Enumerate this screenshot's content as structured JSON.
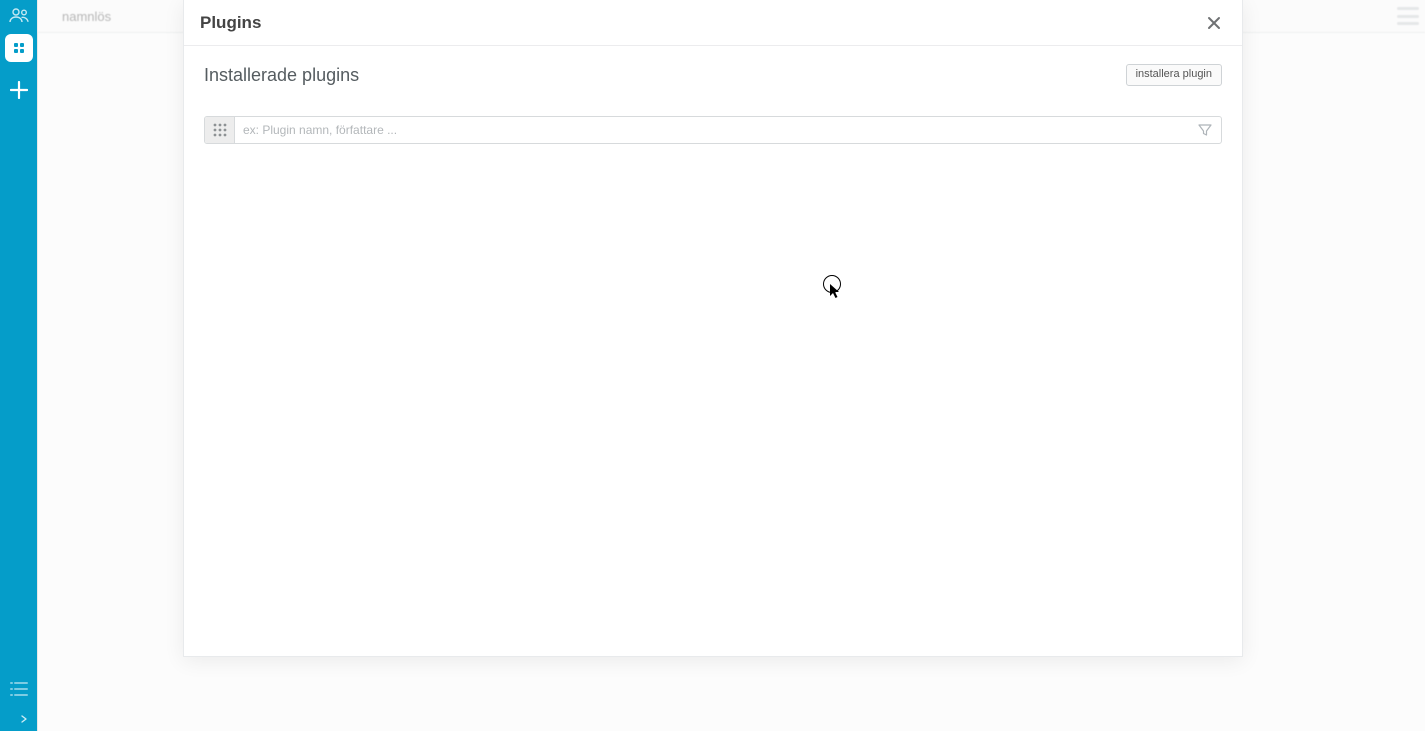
{
  "sidebar": {
    "add_label": "+"
  },
  "page": {
    "title": "namnlös"
  },
  "modal": {
    "title": "Plugins",
    "subtitle": "Installerade plugins",
    "install_btn": "installera plugin",
    "search_placeholder": "ex: Plugin namn, författare ..."
  }
}
